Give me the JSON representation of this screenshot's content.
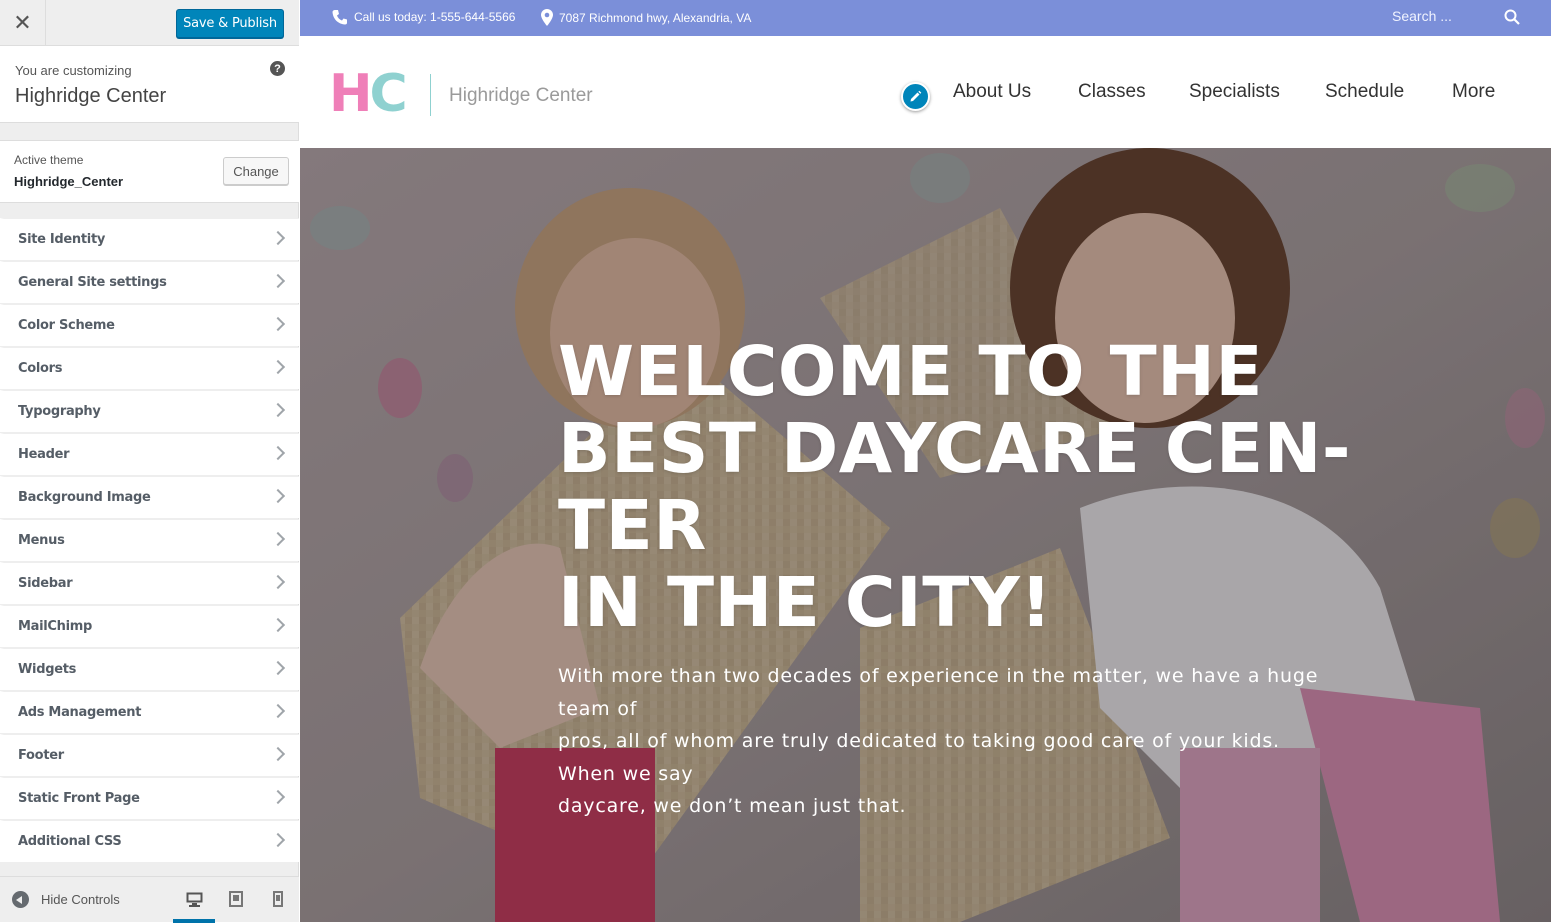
{
  "customizer": {
    "save_publish": "Save & Publish",
    "customizing_label": "You are customizing",
    "site_title": "Highridge Center",
    "help_icon": "?",
    "active_theme_label": "Active theme",
    "active_theme_name": "Highridge_Center",
    "change_label": "Change",
    "sections": [
      {
        "label": "Site Identity"
      },
      {
        "label": "General Site settings"
      },
      {
        "label": "Color Scheme"
      },
      {
        "label": "Colors"
      },
      {
        "label": "Typography"
      },
      {
        "label": "Header"
      },
      {
        "label": "Background Image"
      },
      {
        "label": "Menus"
      },
      {
        "label": "Sidebar"
      },
      {
        "label": "MailChimp"
      },
      {
        "label": "Widgets"
      },
      {
        "label": "Ads Management"
      },
      {
        "label": "Footer"
      },
      {
        "label": "Static Front Page"
      },
      {
        "label": "Additional CSS"
      }
    ],
    "hide_controls": "Hide Controls",
    "devices": [
      "desktop-icon",
      "tablet-icon",
      "mobile-icon"
    ],
    "active_device": "desktop",
    "accent_color": "#0085ba"
  },
  "site": {
    "topbar": {
      "phone": "Call us today: 1-555-644-5566",
      "address": "7087 Richmond hwy, Alexandria, VA",
      "search_placeholder": "Search ...",
      "color": "#7b8fd9"
    },
    "logo": {
      "mark_h": "H",
      "mark_c": "C",
      "name": "Highridge Center"
    },
    "nav": [
      "About Us",
      "Classes",
      "Specialists",
      "Schedule",
      "More"
    ],
    "hero": {
      "title_lines": [
        "WELCOME TO THE",
        "BEST DAYCARE CEN-",
        "TER",
        "IN THE CITY!"
      ],
      "text_lines": [
        "With more than two decades of experience in the matter, we have a huge",
        "team of",
        "pros, all of whom are truly dedicated to taking good care of your kids.",
        "When we say",
        "daycare, we don’t mean just that."
      ]
    }
  }
}
